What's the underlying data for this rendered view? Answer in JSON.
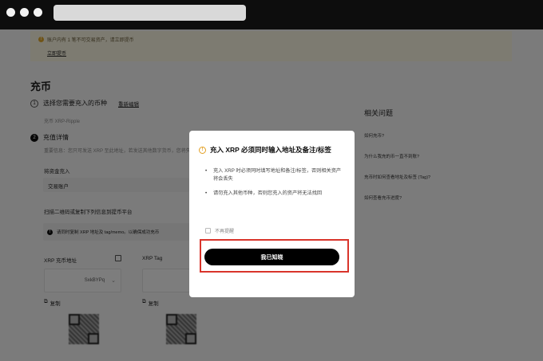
{
  "notice": {
    "text": "账户内有 1 笔不可交易资产，请立即提币",
    "link": "立即提币"
  },
  "page": {
    "title": "充币",
    "step1_label": "选择您需要充入的币种",
    "step1_number": "1",
    "step1_action": "重新编辑",
    "step1_value": "充币 XRP-Ripple",
    "step2_number": "2",
    "step2_label": "充值详情",
    "step2_desc": "重要信息：您只可发送 XRP 至此地址，若发送其他数字货币，您将失去",
    "account_label": "将资金充入",
    "account_value": "交易账户",
    "scan_label": "扫描二维码或复制下列信息到提币平台",
    "info_text": "请同时复制 XRP 地址及 tag/memo。以确保成功充币",
    "address_label": "XRP 充币地址",
    "address_value": "SxkBYPq",
    "tag_label": "XRP Tag",
    "copy_label": "复制",
    "copy_label_2": "复制"
  },
  "related": {
    "title": "相关问题",
    "questions": [
      "如何充币?",
      "为什么我充的币一直不到账?",
      "充币时如何查看地址及标签 (Tag)?",
      "如何查看充币进度?"
    ]
  },
  "modal": {
    "title": "充入 XRP 必须同时输入地址及备注/标签",
    "bullets": [
      "充入 XRP 时必须同时填写地址和备注/标签，否则相关资产将会丢失",
      "请勿充入其他币种，否则您充入的资产将无法找回"
    ],
    "checkbox_label": "不再提醒",
    "confirm_label": "我已知晓"
  },
  "colors": {
    "accent": "#000000",
    "highlight_outline": "#d9342b",
    "warning": "#e3a024"
  }
}
